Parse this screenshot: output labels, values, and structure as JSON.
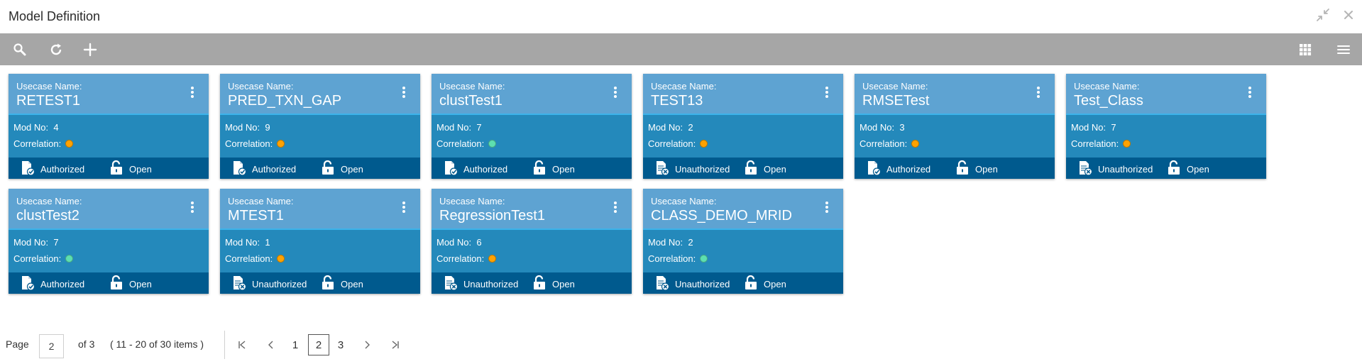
{
  "window": {
    "title": "Model Definition"
  },
  "card_labels": {
    "usecase": "Usecase Name:",
    "mod": "Mod No:",
    "correlation": "Correlation:",
    "open": "Open"
  },
  "colors": {
    "orange": "#ffa200",
    "green": "#5ddfb0"
  },
  "cards": [
    {
      "name": "RETEST1",
      "mod": "4",
      "correlation_color": "#ffa200",
      "status": "Authorized",
      "status_icon": "authorized-doc-icon"
    },
    {
      "name": "PRED_TXN_GAP",
      "mod": "9",
      "correlation_color": "#ffa200",
      "status": "Authorized",
      "status_icon": "authorized-doc-icon"
    },
    {
      "name": "clustTest1",
      "mod": "7",
      "correlation_color": "#5ddfb0",
      "status": "Authorized",
      "status_icon": "authorized-doc-icon"
    },
    {
      "name": "TEST13",
      "mod": "2",
      "correlation_color": "#ffa200",
      "status": "Unauthorized",
      "status_icon": "unauthorized-doc-icon"
    },
    {
      "name": "RMSETest",
      "mod": "3",
      "correlation_color": "#ffa200",
      "status": "Authorized",
      "status_icon": "authorized-doc-icon"
    },
    {
      "name": "Test_Class",
      "mod": "7",
      "correlation_color": "#ffa200",
      "status": "Unauthorized",
      "status_icon": "unauthorized-doc-icon"
    },
    {
      "name": "clustTest2",
      "mod": "7",
      "correlation_color": "#5ddfb0",
      "status": "Authorized",
      "status_icon": "authorized-doc-icon"
    },
    {
      "name": "MTEST1",
      "mod": "1",
      "correlation_color": "#ffa200",
      "status": "Unauthorized",
      "status_icon": "unauthorized-doc-icon"
    },
    {
      "name": "RegressionTest1",
      "mod": "6",
      "correlation_color": "#ffa200",
      "status": "Unauthorized",
      "status_icon": "unauthorized-doc-icon"
    },
    {
      "name": "CLASS_DEMO_MRID",
      "mod": "2",
      "correlation_color": "#5ddfb0",
      "status": "Unauthorized",
      "status_icon": "unauthorized-doc-icon"
    }
  ],
  "pagination": {
    "page_label": "Page",
    "current_page": "2",
    "of_label": "of 3",
    "range_label": "( 11 - 20 of 30 items )",
    "pages": [
      "1",
      "2",
      "3"
    ]
  }
}
